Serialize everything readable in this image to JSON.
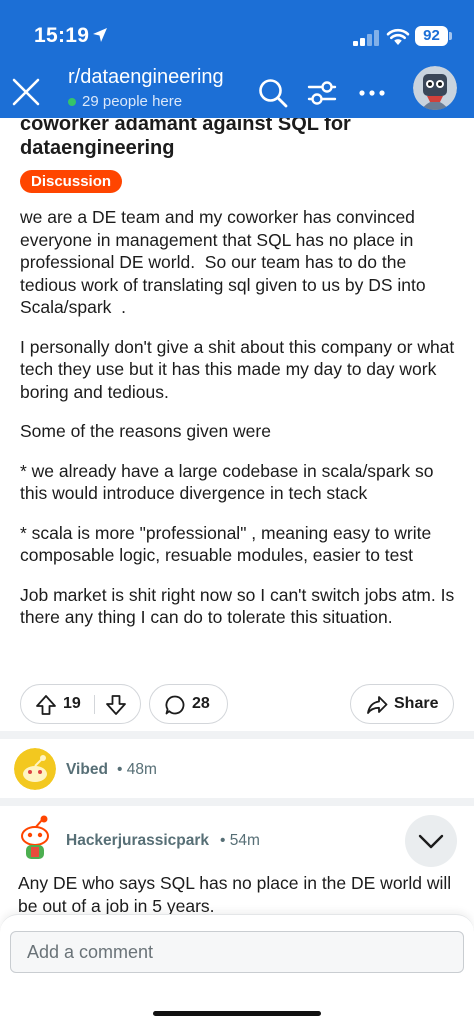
{
  "status_bar": {
    "time": "15:19",
    "battery": "92",
    "icons": [
      "location-arrow-icon",
      "cellular-signal-icon",
      "wifi-icon",
      "battery-icon"
    ]
  },
  "nav": {
    "subreddit": "r/dataengineering",
    "online": "29 people here",
    "icons": [
      "close-icon",
      "search-icon",
      "filter-icon",
      "more-icon",
      "avatar"
    ]
  },
  "post": {
    "title": "coworker adamant against SQL for\ndataengineering",
    "flair": "Discussion",
    "paragraphs": [
      "we are a DE team and my coworker has convinced everyone in management that SQL has no place in professional DE world.  So our team has to do the tedious work of translating sql given to us by DS into Scala/spark  .",
      "I personally don't give a shit about this company or what tech they use but it has this made my day to day work boring and tedious.",
      "Some of the reasons given were",
      "* we already have a large codebase in scala/spark so this would introduce divergence in tech stack",
      "* scala is more \"professional\" , meaning easy to write composable logic, resuable modules, easier to test",
      "Job market is shit right now so I can't switch jobs atm. Is there any thing I can do to tolerate this situation."
    ],
    "votes": "19",
    "comments": "28",
    "share_label": "Share"
  },
  "comments": [
    {
      "author": "Vibed",
      "time": "48m"
    },
    {
      "author": "Hackerjurassicpark",
      "time": "54m",
      "text": "Any DE who says SQL has no place in the DE world will be out of a job in 5 years."
    }
  ],
  "composer": {
    "placeholder": "Add a comment"
  },
  "colors": {
    "header_blue": "#1c6fd6",
    "flair_orange": "#ff4500",
    "online_green": "#35c46a"
  }
}
